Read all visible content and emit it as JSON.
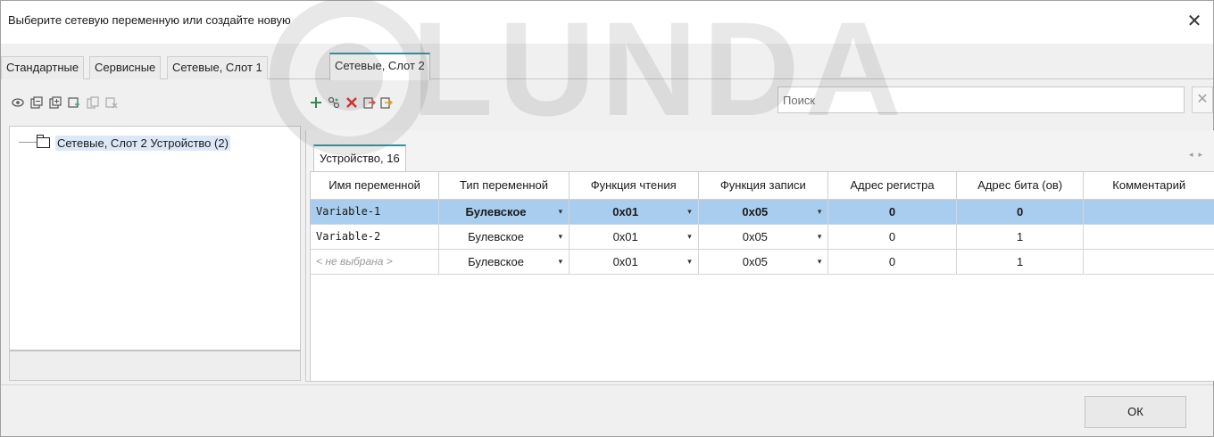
{
  "window": {
    "title": "Выберите сетевую переменную или создайте новую"
  },
  "watermark": {
    "text": "LUNDA"
  },
  "tabs": [
    {
      "label": "Стандартные"
    },
    {
      "label": "Сервисные"
    },
    {
      "label": "Сетевые, Слот 1"
    },
    {
      "label": "Сетевые, Слот 2",
      "active": true
    }
  ],
  "search": {
    "placeholder": "Поиск"
  },
  "tree": {
    "node_label": "Сетевые, Слот 2 Устройство (2)"
  },
  "device_tab": {
    "label": "Устройство, 16"
  },
  "table": {
    "columns": [
      "Имя переменной",
      "Тип переменной",
      "Функция чтения",
      "Функция записи",
      "Адрес регистра",
      "Адрес бита (ов)",
      "Комментарий"
    ],
    "rows": [
      {
        "name": "Variable-1",
        "type": "Булевское",
        "read": "0x01",
        "write": "0x05",
        "reg": "0",
        "bit": "0",
        "comment": "",
        "selected": true
      },
      {
        "name": "Variable-2",
        "type": "Булевское",
        "read": "0x01",
        "write": "0x05",
        "reg": "0",
        "bit": "1",
        "comment": ""
      },
      {
        "name": "< не выбрана >",
        "type": "Булевское",
        "read": "0x01",
        "write": "0x05",
        "reg": "0",
        "bit": "1",
        "comment": ""
      }
    ]
  },
  "buttons": {
    "ok": "ОК"
  },
  "colors": {
    "accent": "#2f8f9d",
    "selection": "#a9cdef",
    "delete_red": "#e02424",
    "add_green": "#2e8b57"
  }
}
